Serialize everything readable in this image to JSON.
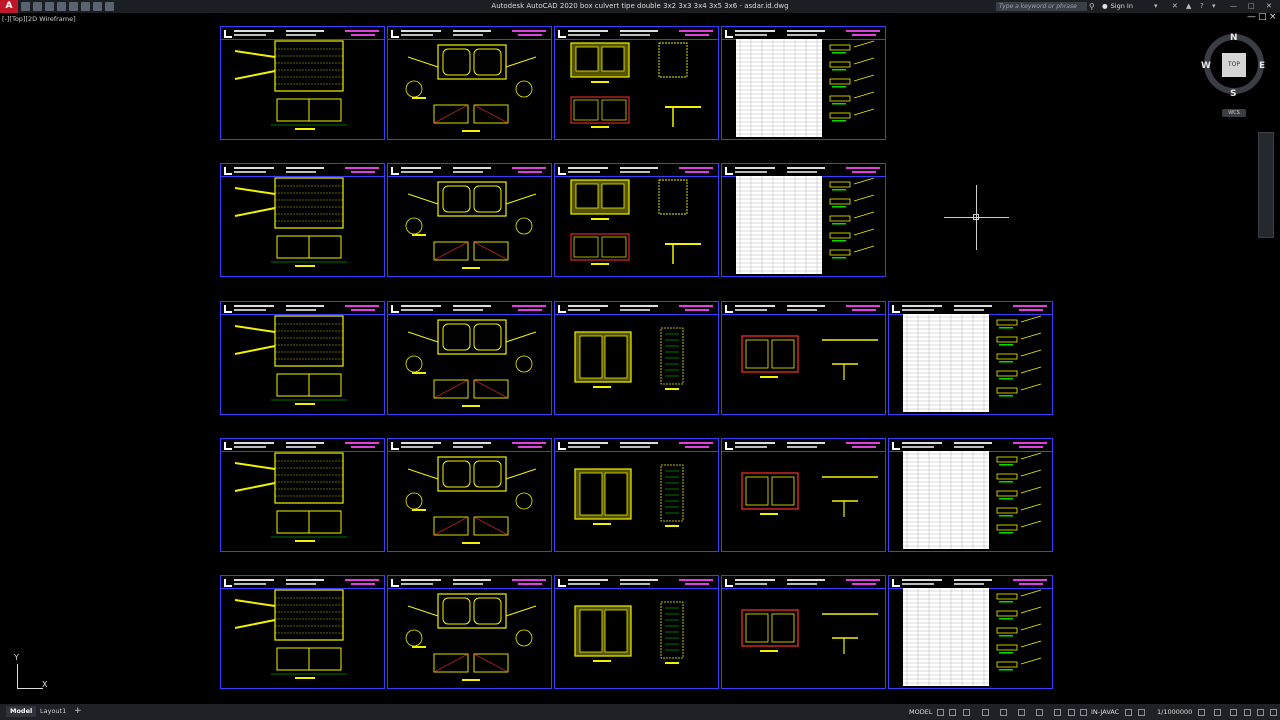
{
  "titlebar": {
    "app_icon": "A",
    "title": "Autodesk AutoCAD 2020   box culvert tipe double 3x2 3x3 3x4 3x5 3x6 - asdar.id.dwg",
    "search_placeholder": "Type a keyword or phrase",
    "sign_in": "Sign In",
    "icons": [
      "new-icon",
      "open-icon",
      "save-icon",
      "saveas-icon",
      "print-icon",
      "undo-icon",
      "redo-icon",
      "share-icon",
      "search-icon",
      "user-icon",
      "help-icon",
      "minimize-icon",
      "restore-icon",
      "close-icon"
    ]
  },
  "viewport": {
    "label": "[-][Top][2D Wireframe]"
  },
  "viewcube": {
    "north": "N",
    "south": "S",
    "east": "E",
    "west": "W",
    "face": "TOP",
    "wcs": "WCS"
  },
  "ucs": {
    "x": "X",
    "y": "Y"
  },
  "drawing_rows": [
    {
      "sheets": [
        "plan",
        "section",
        "reinforcement",
        "table"
      ]
    },
    {
      "sheets": [
        "plan",
        "section",
        "reinforcement",
        "table"
      ]
    },
    {
      "sheets": [
        "plan",
        "section",
        "box",
        "reinforcement",
        "table"
      ]
    },
    {
      "sheets": [
        "plan",
        "section",
        "box",
        "reinforcement",
        "table"
      ]
    },
    {
      "sheets": [
        "plan",
        "section",
        "box",
        "reinforcement",
        "table"
      ]
    }
  ],
  "statusbar": {
    "tabs": [
      "Model",
      "Layout1"
    ],
    "add_tab": "+",
    "model": "MODEL",
    "units": "IN-JAVAC",
    "scale": "1/1000000"
  },
  "colors": {
    "sheet_border": "#3c3cff",
    "yellow": "#f2f200",
    "green": "#00e000",
    "magenta": "#e040e0",
    "red": "#ff3030",
    "cyan": "#00d8e8"
  }
}
